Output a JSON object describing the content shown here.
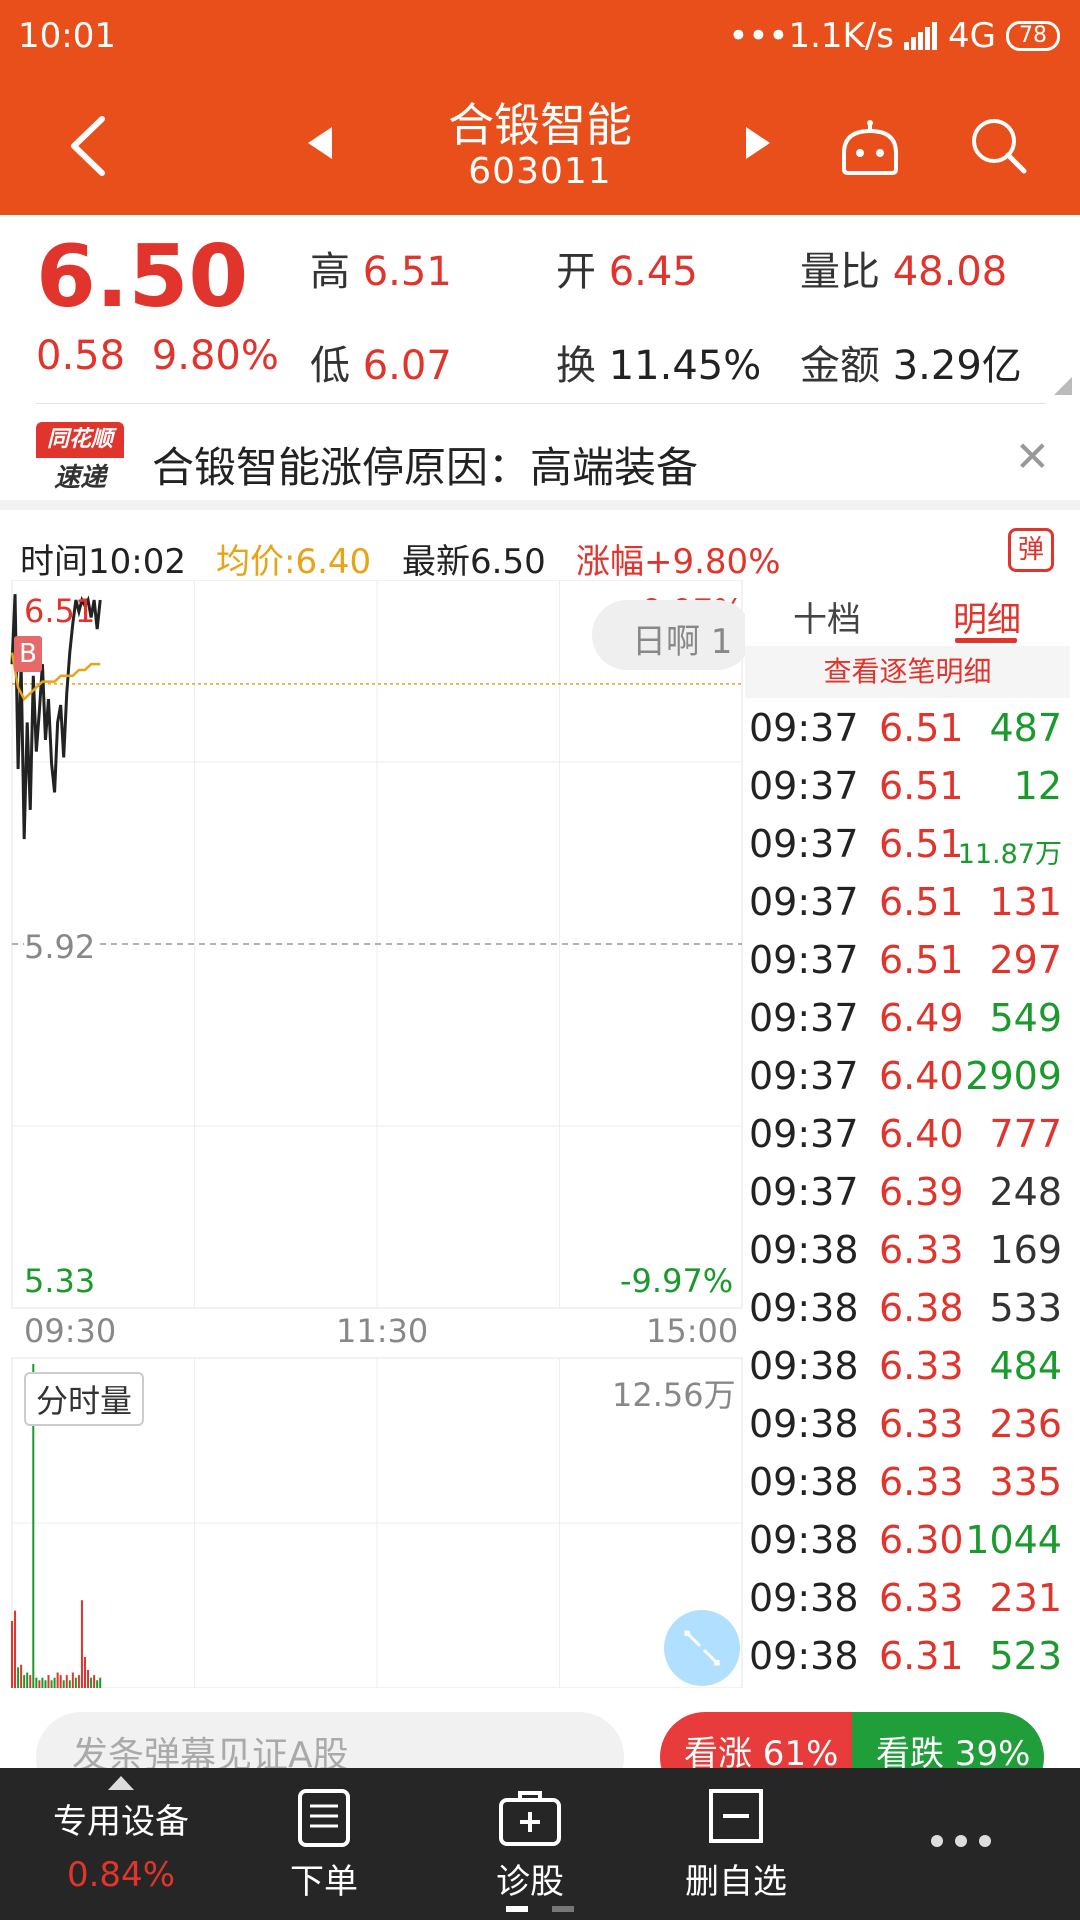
{
  "status": {
    "time": "10:01",
    "network_speed": "•••1.1K/s",
    "network_type": "4G",
    "battery": "78"
  },
  "header": {
    "stock_name": "合锻智能",
    "stock_code": "603011"
  },
  "quote": {
    "price": "6.50",
    "change": "0.58",
    "change_pct": "9.80%",
    "high_label": "高",
    "high_value": "6.51",
    "low_label": "低",
    "low_value": "6.07",
    "open_label": "开",
    "open_value": "6.45",
    "turnover_label": "换",
    "turnover_value": "11.45%",
    "volume_ratio_label": "量比",
    "volume_ratio_value": "48.08",
    "amount_label": "金额",
    "amount_value": "3.29亿"
  },
  "news": {
    "logo_line1": "同花顺",
    "logo_line2": "速递",
    "text": "合锻智能涨停原因：高端装备"
  },
  "chart_info": {
    "time": "时间10:02",
    "avg_price": "均价:6.40",
    "latest": "最新6.50",
    "change": "涨幅+9.80%",
    "barrage_toggle": "弹"
  },
  "chart_data": {
    "type": "line",
    "y_top_label": "6.51",
    "y_mid_label": "5.92",
    "y_bottom_label": "5.33",
    "pct_top_label": "+9.97%",
    "pct_bottom_label": "-9.97%",
    "x_ticks": [
      "09:30",
      "11:30",
      "15:00"
    ],
    "ylim": [
      5.33,
      6.51
    ],
    "reference_price": 5.92,
    "session_minutes": 240,
    "price_series": [
      [
        0,
        6.4
      ],
      [
        1,
        6.52
      ],
      [
        2,
        6.22
      ],
      [
        3,
        6.4
      ],
      [
        4,
        6.1
      ],
      [
        5,
        6.3
      ],
      [
        6,
        6.15
      ],
      [
        7,
        6.38
      ],
      [
        8,
        6.25
      ],
      [
        9,
        6.32
      ],
      [
        10,
        6.4
      ],
      [
        11,
        6.27
      ],
      [
        12,
        6.34
      ],
      [
        13,
        6.23
      ],
      [
        14,
        6.18
      ],
      [
        15,
        6.3
      ],
      [
        16,
        6.33
      ],
      [
        17,
        6.24
      ],
      [
        18,
        6.35
      ],
      [
        19,
        6.42
      ],
      [
        20,
        6.47
      ],
      [
        21,
        6.51
      ],
      [
        22,
        6.49
      ],
      [
        23,
        6.51
      ],
      [
        24,
        6.5
      ],
      [
        25,
        6.51
      ],
      [
        26,
        6.48
      ],
      [
        27,
        6.51
      ],
      [
        28,
        6.46
      ],
      [
        29,
        6.51
      ]
    ],
    "avg_series": [
      [
        0,
        6.42
      ],
      [
        2,
        6.36
      ],
      [
        4,
        6.34
      ],
      [
        6,
        6.35
      ],
      [
        8,
        6.36
      ],
      [
        10,
        6.37
      ],
      [
        12,
        6.37
      ],
      [
        14,
        6.37
      ],
      [
        16,
        6.38
      ],
      [
        18,
        6.38
      ],
      [
        20,
        6.38
      ],
      [
        22,
        6.39
      ],
      [
        24,
        6.39
      ],
      [
        26,
        6.4
      ],
      [
        28,
        6.4
      ],
      [
        29,
        6.4
      ]
    ],
    "volume_label": "分时量",
    "volume_max_label": "12.56万",
    "volume_max": 125600,
    "volume_bars": [
      {
        "m": 0,
        "v": 26000,
        "c": "red"
      },
      {
        "m": 1,
        "v": 30000,
        "c": "red"
      },
      {
        "m": 2,
        "v": 8000,
        "c": "green"
      },
      {
        "m": 3,
        "v": 9000,
        "c": "red"
      },
      {
        "m": 4,
        "v": 5000,
        "c": "green"
      },
      {
        "m": 5,
        "v": 6000,
        "c": "green"
      },
      {
        "m": 6,
        "v": 5000,
        "c": "red"
      },
      {
        "m": 7,
        "v": 125600,
        "c": "green"
      },
      {
        "m": 8,
        "v": 4000,
        "c": "green"
      },
      {
        "m": 9,
        "v": 3000,
        "c": "red"
      },
      {
        "m": 10,
        "v": 4000,
        "c": "green"
      },
      {
        "m": 11,
        "v": 3000,
        "c": "green"
      },
      {
        "m": 12,
        "v": 5000,
        "c": "red"
      },
      {
        "m": 13,
        "v": 3000,
        "c": "green"
      },
      {
        "m": 14,
        "v": 4000,
        "c": "green"
      },
      {
        "m": 15,
        "v": 6000,
        "c": "red"
      },
      {
        "m": 16,
        "v": 5000,
        "c": "red"
      },
      {
        "m": 17,
        "v": 3000,
        "c": "green"
      },
      {
        "m": 18,
        "v": 5000,
        "c": "red"
      },
      {
        "m": 19,
        "v": 3000,
        "c": "green"
      },
      {
        "m": 20,
        "v": 6000,
        "c": "red"
      },
      {
        "m": 21,
        "v": 4000,
        "c": "green"
      },
      {
        "m": 22,
        "v": 5000,
        "c": "red"
      },
      {
        "m": 23,
        "v": 34000,
        "c": "red"
      },
      {
        "m": 24,
        "v": 12000,
        "c": "red"
      },
      {
        "m": 25,
        "v": 7000,
        "c": "red"
      },
      {
        "m": 26,
        "v": 4000,
        "c": "green"
      },
      {
        "m": 27,
        "v": 5000,
        "c": "red"
      },
      {
        "m": 28,
        "v": 3000,
        "c": "green"
      },
      {
        "m": 29,
        "v": 4000,
        "c": "green"
      }
    ]
  },
  "danmu": {
    "bubble_text": "日啊 1"
  },
  "side_panel": {
    "tab_ten": "十档",
    "tab_detail": "明细",
    "detail_link": "查看逐笔明细",
    "ticks": [
      {
        "time": "09:37",
        "price": "6.51",
        "vol": "487",
        "color": "green"
      },
      {
        "time": "09:37",
        "price": "6.51",
        "vol": "12",
        "color": "green"
      },
      {
        "time": "09:37",
        "price": "6.51",
        "vol": "11.87万",
        "color": "green",
        "small": true
      },
      {
        "time": "09:37",
        "price": "6.51",
        "vol": "131",
        "color": "red"
      },
      {
        "time": "09:37",
        "price": "6.51",
        "vol": "297",
        "color": "red"
      },
      {
        "time": "09:37",
        "price": "6.49",
        "vol": "549",
        "color": "green"
      },
      {
        "time": "09:37",
        "price": "6.40",
        "vol": "2909",
        "color": "green"
      },
      {
        "time": "09:37",
        "price": "6.40",
        "vol": "777",
        "color": "red"
      },
      {
        "time": "09:37",
        "price": "6.39",
        "vol": "248",
        "color": "gray"
      },
      {
        "time": "09:38",
        "price": "6.33",
        "vol": "169",
        "color": "gray"
      },
      {
        "time": "09:38",
        "price": "6.38",
        "vol": "533",
        "color": "gray"
      },
      {
        "time": "09:38",
        "price": "6.33",
        "vol": "484",
        "color": "green"
      },
      {
        "time": "09:38",
        "price": "6.33",
        "vol": "236",
        "color": "red"
      },
      {
        "time": "09:38",
        "price": "6.33",
        "vol": "335",
        "color": "red"
      },
      {
        "time": "09:38",
        "price": "6.30",
        "vol": "1044",
        "color": "green"
      },
      {
        "time": "09:38",
        "price": "6.33",
        "vol": "231",
        "color": "red"
      },
      {
        "time": "09:38",
        "price": "6.31",
        "vol": "523",
        "color": "green"
      }
    ]
  },
  "barrage": {
    "placeholder": "发条弹幕见证A股",
    "vote_up": "看涨 61%",
    "vote_down": "看跌 39%",
    "up_pct": 61
  },
  "bottom_nav": {
    "sector_name": "专用设备",
    "sector_change": "0.84%",
    "order": "下单",
    "diagnose": "诊股",
    "remove_watch": "删自选"
  },
  "colors": {
    "brand": "#e84f1a",
    "up": "#e0342c",
    "down": "#1a9a2c",
    "avg_line": "#e8a317",
    "price_line": "#222222"
  }
}
